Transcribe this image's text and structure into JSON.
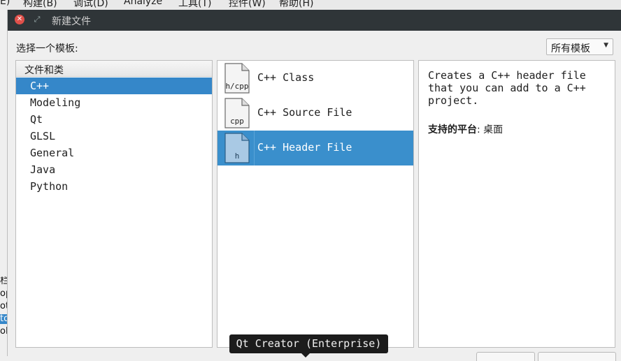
{
  "menubar": {
    "items": [
      "E)",
      "构建(B)",
      "调试(D)",
      "Analyze",
      "工具(T)",
      "控件(W)",
      "帮助(H)"
    ]
  },
  "background_left": {
    "fragments": [
      "栏",
      "op",
      "ot",
      "to",
      "ol"
    ]
  },
  "dialog": {
    "title": "新建文件",
    "choose_label": "选择一个模板:",
    "filter_combo": {
      "value": "所有模板"
    },
    "categories": {
      "header": "文件和类",
      "items": [
        "C++",
        "Modeling",
        "Qt",
        "GLSL",
        "General",
        "Java",
        "Python"
      ],
      "selected": "C++"
    },
    "templates": [
      {
        "label": "C++ Class",
        "icon_ext": "h/cpp",
        "selected": false
      },
      {
        "label": "C++ Source File",
        "icon_ext": "cpp",
        "selected": false
      },
      {
        "label": "C++ Header File",
        "icon_ext": "h",
        "selected": true
      }
    ],
    "description": {
      "text": "Creates a C++ header file that you can add to a C++ project.",
      "platform_label": "支持的平台",
      "platform_value": ": 桌面"
    }
  },
  "tooltip": "Qt Creator (Enterprise)",
  "colors": {
    "selection": "#3587c9",
    "titlebar": "#2f3538",
    "close_button": "#e0504a",
    "tooltip_bg": "#1c1c1c"
  }
}
